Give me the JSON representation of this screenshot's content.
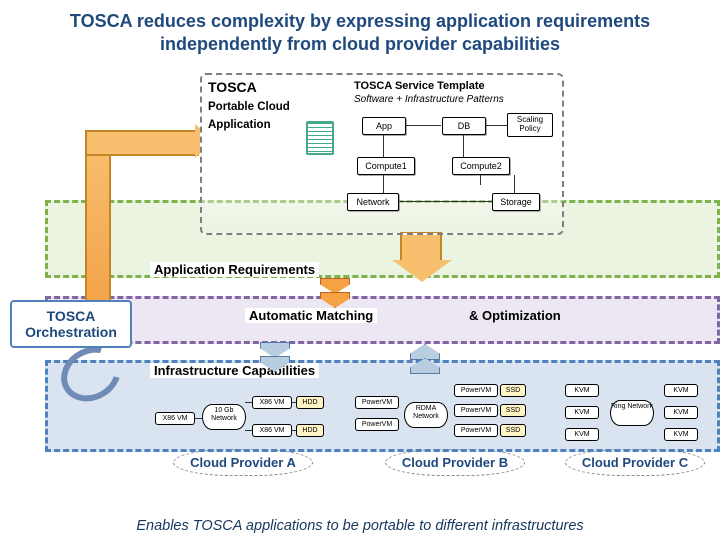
{
  "title": "TOSCA reduces complexity by expressing application requirements independently from cloud provider capabilities",
  "tosca": {
    "heading": "TOSCA",
    "subtitle": "Portable Cloud Application",
    "template_title": "TOSCA Service Template",
    "template_subtitle": "Software + Infrastructure Patterns",
    "nodes": {
      "app": "App",
      "db": "DB",
      "scaling": "Scaling Policy",
      "compute1": "Compute1",
      "compute2": "Compute2",
      "network": "Network",
      "storage": "Storage"
    }
  },
  "bands": {
    "req": "Application Requirements",
    "match": "Automatic Matching",
    "opt": "& Optimization",
    "infra": "Infrastructure Capabilities"
  },
  "orchestration": "TOSCA Orchestration",
  "providers": {
    "a": {
      "name": "Cloud Provider A",
      "vm": "X86 VM",
      "net": "10 Gb Network",
      "disk": "HDD"
    },
    "b": {
      "name": "Cloud Provider B",
      "vm": "PowerVM",
      "net": "RDMA Network",
      "disk": "SSD"
    },
    "c": {
      "name": "Cloud Provider C",
      "vm": "KVM",
      "net": "Ring Network"
    }
  },
  "footer": "Enables TOSCA applications to be portable to different infrastructures"
}
